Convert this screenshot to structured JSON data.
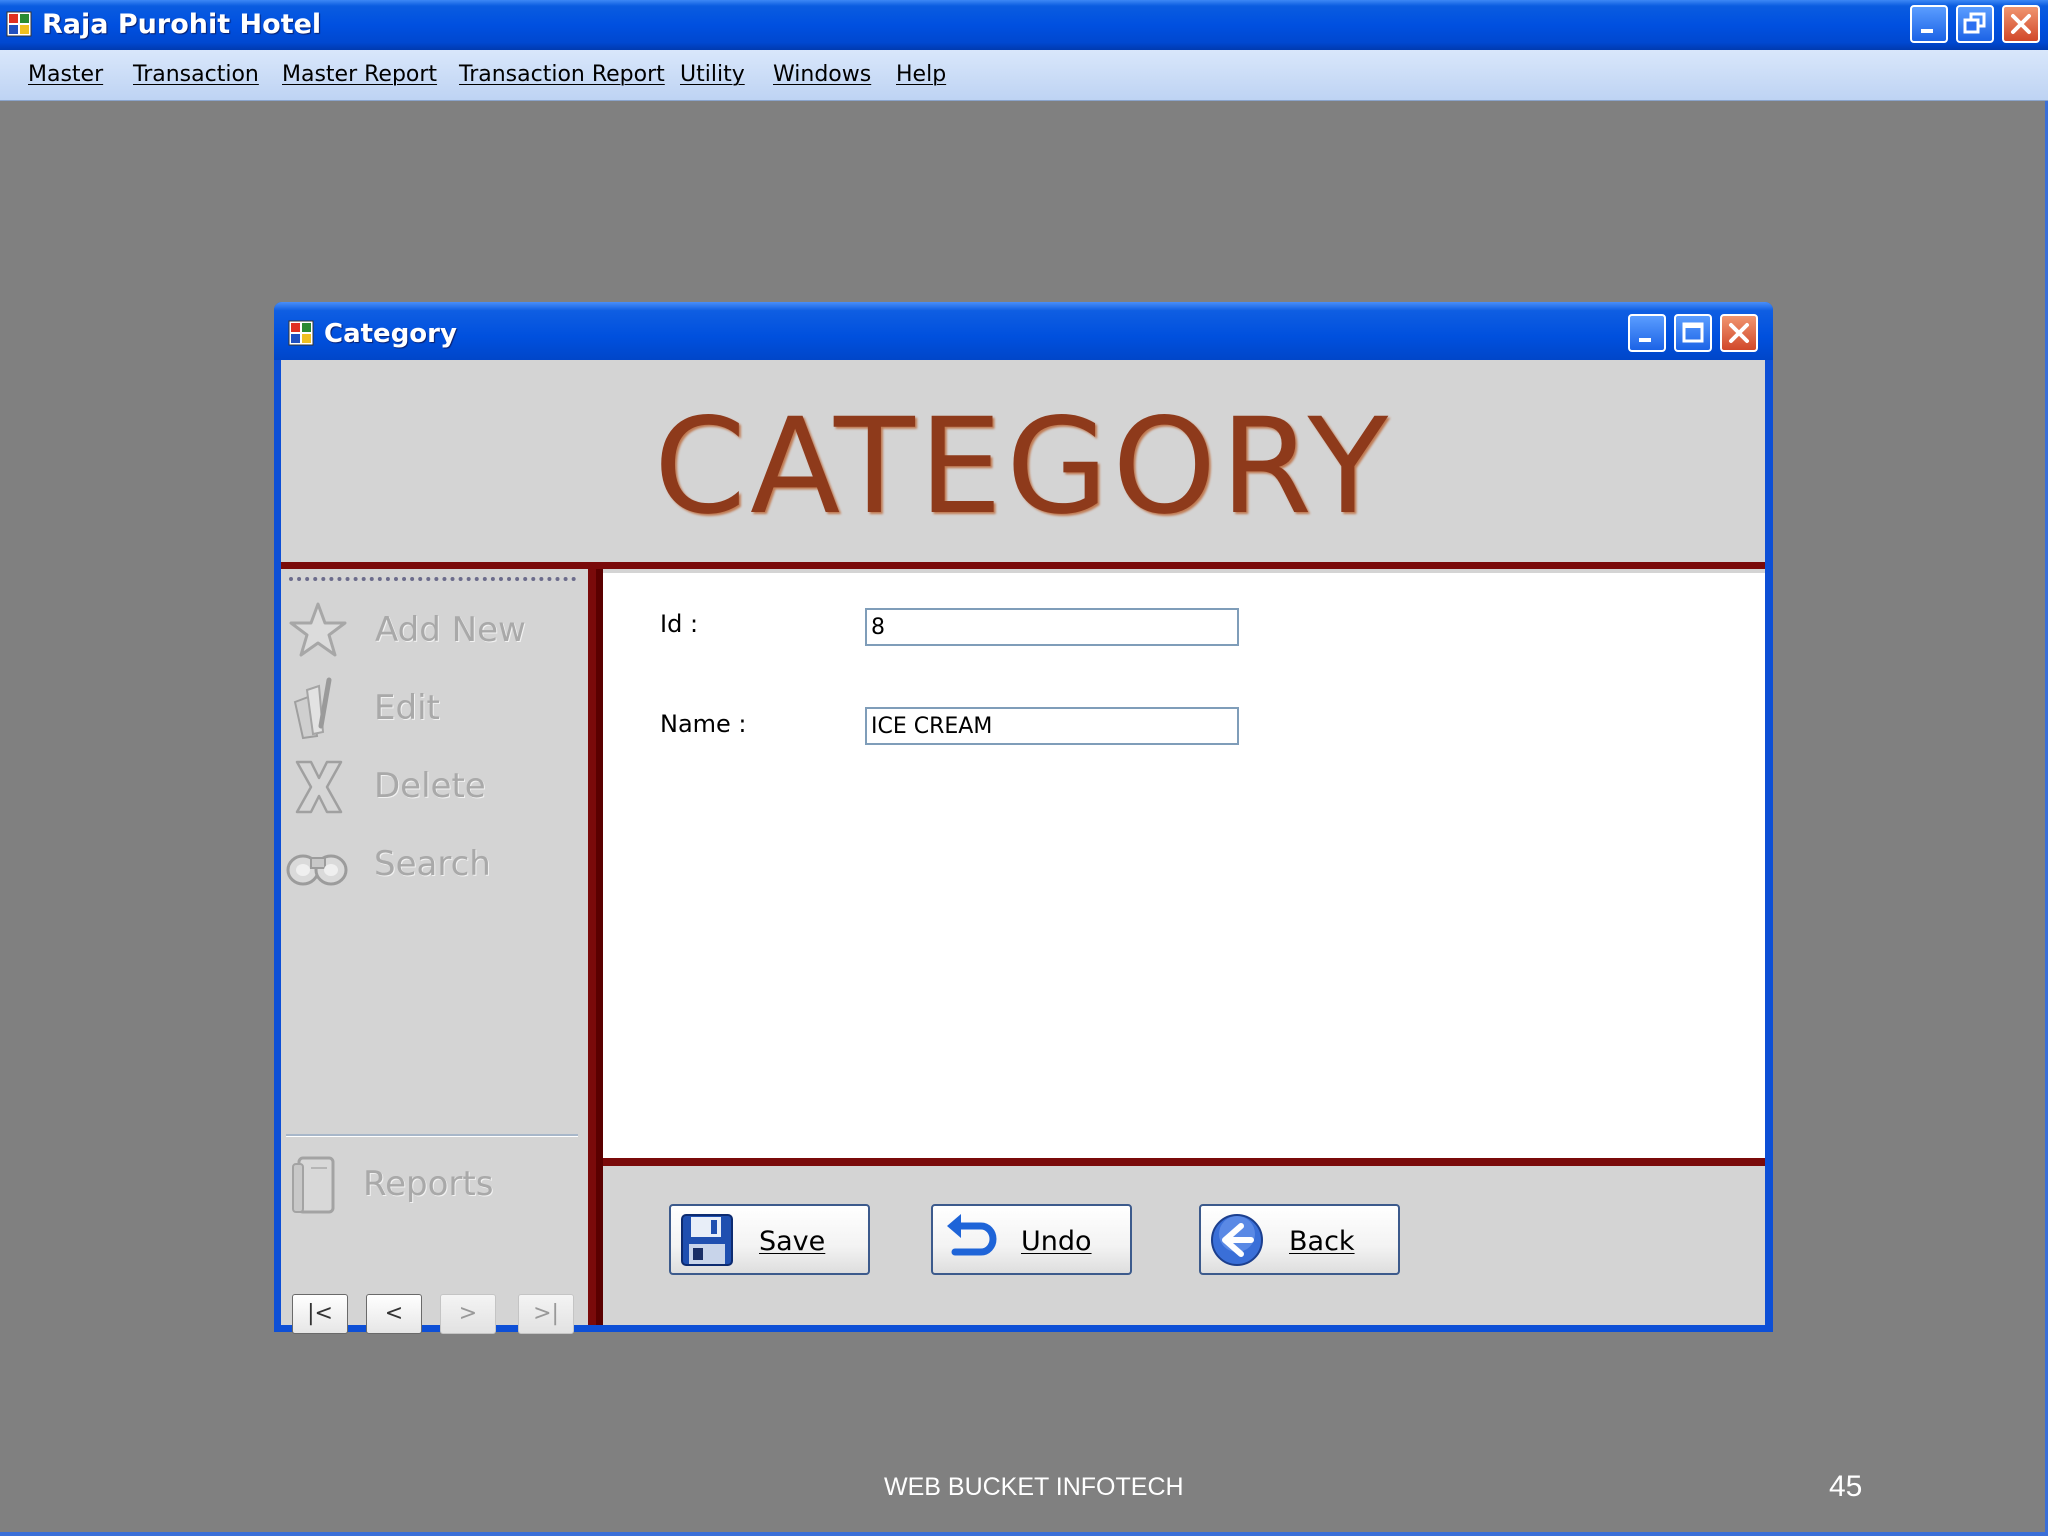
{
  "app": {
    "title": "Raja Purohit Hotel"
  },
  "menu": [
    {
      "label": "Master"
    },
    {
      "label": "Transaction"
    },
    {
      "label": "Master Report"
    },
    {
      "label": "Transaction Report"
    },
    {
      "label": "Utility"
    },
    {
      "label": "Windows"
    },
    {
      "label": "Help"
    }
  ],
  "child_window": {
    "title": "Category",
    "header": "CATEGORY"
  },
  "toolbar": {
    "items": [
      {
        "label": "Add New",
        "icon": "star-icon",
        "enabled": false
      },
      {
        "label": "Edit",
        "icon": "edit-icon",
        "enabled": false
      },
      {
        "label": "Delete",
        "icon": "delete-icon",
        "enabled": false
      },
      {
        "label": "Search",
        "icon": "binoculars-icon",
        "enabled": false
      },
      {
        "label": "Reports",
        "icon": "book-icon",
        "enabled": false
      }
    ],
    "nav": [
      {
        "label": "|<",
        "enabled": true
      },
      {
        "label": "<",
        "enabled": true
      },
      {
        "label": ">",
        "enabled": false
      },
      {
        "label": ">|",
        "enabled": false
      }
    ]
  },
  "form": {
    "id_label": "Id :",
    "id_value": "8",
    "name_label": "Name :",
    "name_value": "ICE CREAM"
  },
  "actions": {
    "save": "Save",
    "undo": "Undo",
    "back": "Back"
  },
  "footer": {
    "text": "WEB BUCKET INFOTECH",
    "page": "45"
  },
  "colors": {
    "titlebar": "#0050e0",
    "desktop": "#808080",
    "header_text": "#8e3a1b",
    "rule": "#7a0a0a"
  }
}
